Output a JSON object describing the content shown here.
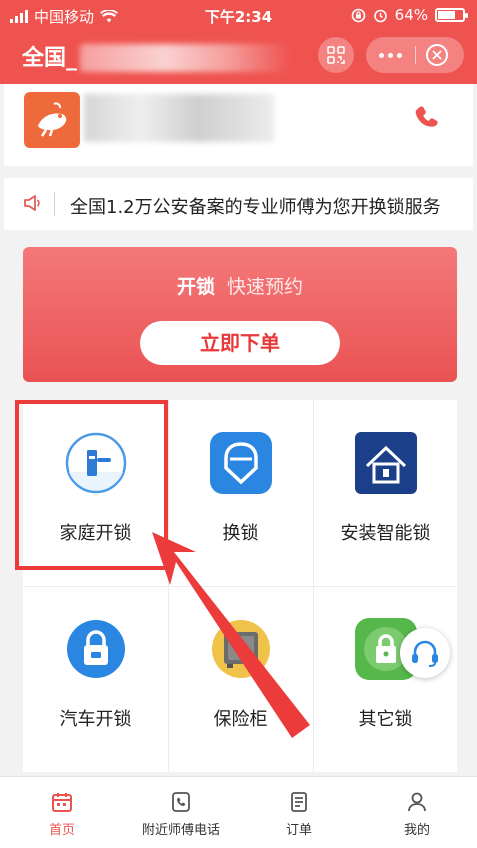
{
  "status_bar": {
    "carrier": "中国移动",
    "time": "下午2:34",
    "battery": "64%"
  },
  "header": {
    "title": "全国_"
  },
  "notice": {
    "text": "全国1.2万公安备案的专业师傅为您开换锁服务"
  },
  "banner": {
    "title": "开锁",
    "subtitle": "快速预约",
    "button": "立即下单"
  },
  "services": [
    {
      "label": "家庭开锁",
      "icon": "door-lock-icon"
    },
    {
      "label": "换锁",
      "icon": "lock-shield-icon"
    },
    {
      "label": "安装智能锁",
      "icon": "smart-home-icon"
    },
    {
      "label": "汽车开锁",
      "icon": "car-lock-icon"
    },
    {
      "label": "保险柜",
      "icon": "safe-icon"
    },
    {
      "label": "其它锁",
      "icon": "padlock-icon"
    }
  ],
  "bottom_nav": [
    {
      "label": "首页",
      "icon": "calendar-home-icon",
      "active": true
    },
    {
      "label": "附近师傅电话",
      "icon": "phone-icon",
      "active": false
    },
    {
      "label": "订单",
      "icon": "order-icon",
      "active": false
    },
    {
      "label": "我的",
      "icon": "user-icon",
      "active": false
    }
  ],
  "colors": {
    "primary": "#ef5350",
    "highlight": "#ec3b3b"
  }
}
